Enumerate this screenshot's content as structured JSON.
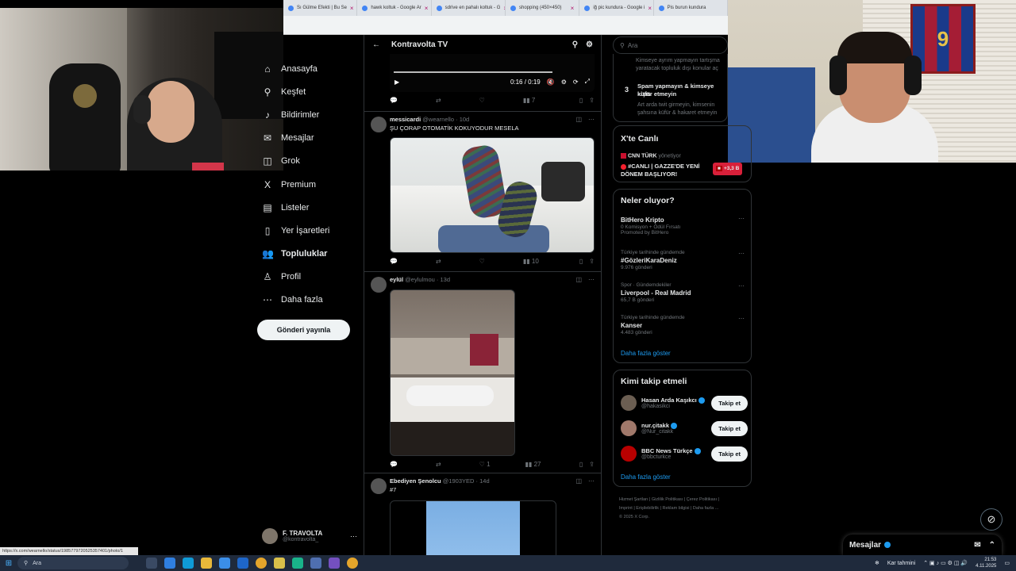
{
  "browser": {
    "tabs": [
      {
        "label": "Sı Gülme Efekti | Bu Se"
      },
      {
        "label": "hawk koltuk - Google Ar"
      },
      {
        "label": "sdrive en pahalı koltuk - G"
      },
      {
        "label": "shopping (450×450)"
      },
      {
        "label": "iğ pic kundura - Google i"
      },
      {
        "label": "Pis burun kundura"
      }
    ],
    "status_url": "https://x.com/wearnello/status/1985779720525357401/photo/1"
  },
  "nav": {
    "items": [
      {
        "label": "Anasayfa",
        "icon": "home-icon",
        "glyph": "⌂"
      },
      {
        "label": "Keşfet",
        "icon": "search-icon",
        "glyph": "⚲"
      },
      {
        "label": "Bildirimler",
        "icon": "bell-icon",
        "glyph": "♪"
      },
      {
        "label": "Mesajlar",
        "icon": "mail-icon",
        "glyph": "✉"
      },
      {
        "label": "Grok",
        "icon": "grok-icon",
        "glyph": "◫"
      },
      {
        "label": "Premium",
        "icon": "x-logo-icon",
        "glyph": "X"
      },
      {
        "label": "Listeler",
        "icon": "list-icon",
        "glyph": "▤"
      },
      {
        "label": "Yer İşaretleri",
        "icon": "bookmark-icon",
        "glyph": "▯"
      },
      {
        "label": "Topluluklar",
        "icon": "communities-icon",
        "glyph": "👥"
      },
      {
        "label": "Profil",
        "icon": "profile-icon",
        "glyph": "♙"
      },
      {
        "label": "Daha fazla",
        "icon": "more-circle-icon",
        "glyph": "⋯"
      }
    ],
    "post_button": "Gönderi yayınla",
    "account": {
      "name": "F. TRAVOLTA",
      "handle": "@kontravolta_"
    }
  },
  "feed": {
    "title": "Kontravolta TV",
    "video": {
      "time": "0:16 / 0:19",
      "views": "7"
    },
    "posts": [
      {
        "name": "messicardi",
        "handle": "@wearnello",
        "age": "· 10d",
        "text": "ŞU ÇORAP OTOMATİK KOKUYODUR MESELA",
        "replies": "",
        "reposts": "",
        "likes": "",
        "views": "10"
      },
      {
        "name": "eylül",
        "handle": "@eylulmou",
        "age": "· 13d",
        "text": "",
        "replies": "",
        "reposts": "",
        "likes": "1",
        "views": "27"
      },
      {
        "name": "Ebediyen Şenolcu",
        "handle": "@1903YED",
        "age": "· 14d",
        "text": "#7"
      }
    ]
  },
  "right": {
    "search_placeholder": "Ara",
    "rules": {
      "line1": "Kimseye ayrım yapmayın tartışma",
      "line2": "yaratacak topluluk dışı konular aç",
      "num": "3",
      "title1": "Spam yapmayın & kimseye kişis",
      "title2": "küfür etmeyin",
      "desc1": "Art arda twit girmeyin, kimsenin",
      "desc2": "şahsına küfür & hakaret etmeyin"
    },
    "live": {
      "title": "X'te Canlı",
      "source": "CNN TÜRK",
      "source_role": "yönetiyor",
      "headline1": "#CANLI | GAZZE'DE YENİ",
      "headline2": "DÖNEM BAŞLIYOR!",
      "viewers": "+3,3 B"
    },
    "trends": {
      "title": "Neler oluyor?",
      "items": [
        {
          "meta": "",
          "name": "BitHero Kripto",
          "count": "0 Komisyon + Ödül Fırsatı",
          "extra": "Promoted by BitHero"
        },
        {
          "meta": "Türkiye tarihinde gündemde",
          "name": "#GözleriKaraDeniz",
          "count": "9.976 gönderi",
          "extra": ""
        },
        {
          "meta": "Spor · Gündemdekiler",
          "name": "Liverpool - Real Madrid",
          "count": "65,7 B gönderi",
          "extra": ""
        },
        {
          "meta": "Türkiye tarihinde gündemde",
          "name": "Kanser",
          "count": "4.483 gönderi",
          "extra": ""
        }
      ],
      "show_more": "Daha fazla göster"
    },
    "follow": {
      "title": "Kimi takip etmeli",
      "items": [
        {
          "name": "Hasan Arda Kaşıkcı",
          "handle": "@hakasikci",
          "button": "Takip et"
        },
        {
          "name": "nur.çitakk",
          "handle": "@Nur_citakk",
          "button": "Takip et"
        },
        {
          "name": "BBC News Türkçe",
          "handle": "@bbcturkce",
          "button": "Takip et"
        }
      ],
      "show_more": "Daha fazla göster"
    },
    "footer": {
      "line1": "Hizmet Şartları  |  Gizlilik Politikası  |  Çerez Politikası  |",
      "line2": "Imprint  |  Erişilebilirlik  |  Reklam bilgisi  |  Daha fazla ...",
      "line3": "© 2025 X Corp."
    }
  },
  "messages": {
    "label": "Mesajlar"
  },
  "taskbar": {
    "search": "Ara",
    "weather": "Kar tahmini",
    "time": "21:53",
    "date": "4.11.2025"
  },
  "cams": {
    "jersey_number": "9"
  }
}
